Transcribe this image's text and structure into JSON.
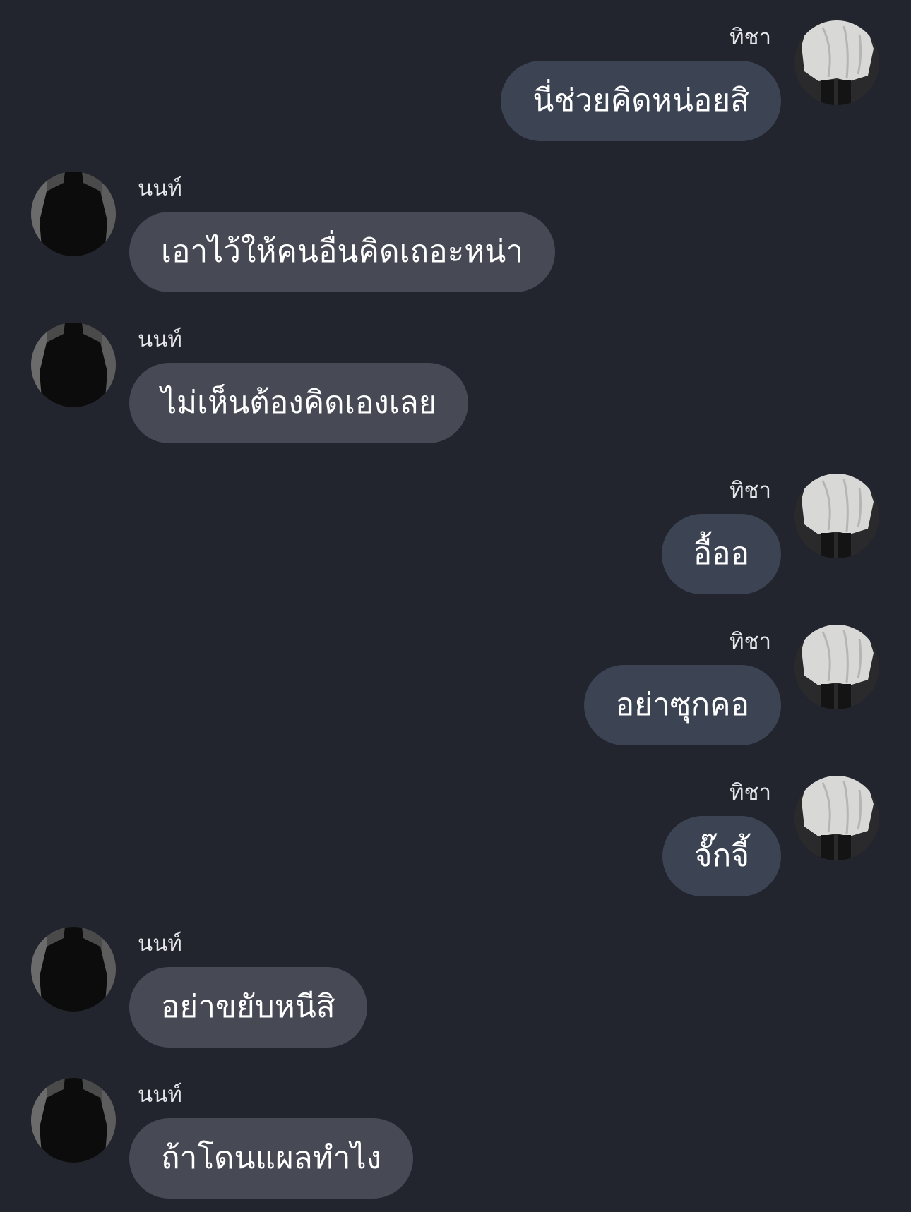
{
  "chat": {
    "participants": {
      "left": {
        "name": "นนท์",
        "avatar_icon": "dark-jacket-back-avatar"
      },
      "right": {
        "name": "ทิชา",
        "avatar_icon": "white-shirt-avatar"
      }
    },
    "messages": [
      {
        "side": "right",
        "sender": "ทิชา",
        "text": "นี่ช่วยคิดหน่อยสิ"
      },
      {
        "side": "left",
        "sender": "นนท์",
        "text": "เอาไว้ให้คนอื่นคิดเถอะหน่า"
      },
      {
        "side": "left",
        "sender": "นนท์",
        "text": "ไม่เห็นต้องคิดเองเลย"
      },
      {
        "side": "right",
        "sender": "ทิชา",
        "text": "อื้ออ"
      },
      {
        "side": "right",
        "sender": "ทิชา",
        "text": "อย่าซุกคอ"
      },
      {
        "side": "right",
        "sender": "ทิชา",
        "text": "จั๊กจี้"
      },
      {
        "side": "left",
        "sender": "นนท์",
        "text": "อย่าขยับหนีสิ"
      },
      {
        "side": "left",
        "sender": "นนท์",
        "text": "ถ้าโดนแผลทำไง"
      }
    ]
  },
  "colors": {
    "background": "#22252e",
    "left_bubble": "#474a55",
    "right_bubble": "#3c4454",
    "text": "#ffffff"
  }
}
